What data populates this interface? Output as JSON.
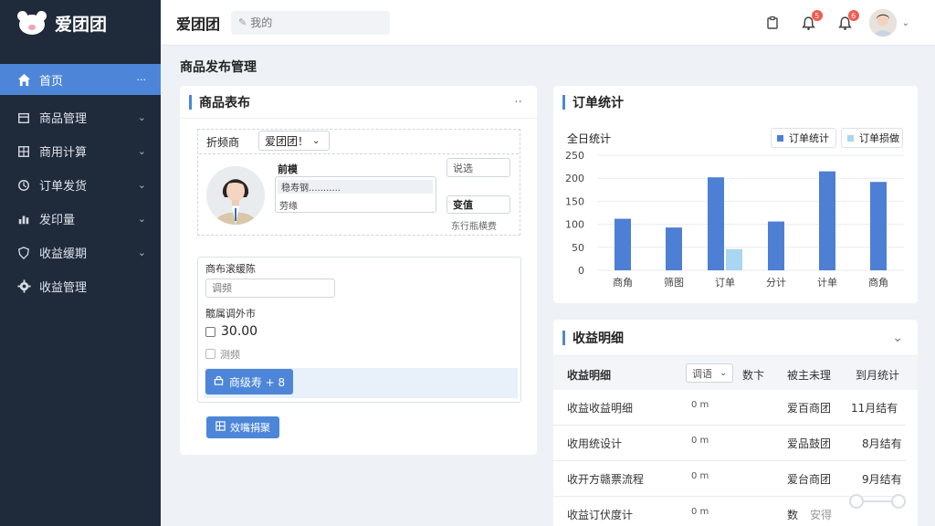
{
  "app": {
    "name": "爱团团"
  },
  "sidebar": {
    "items": [
      {
        "label": "首页",
        "icon": "home-icon",
        "active": true,
        "suffix": "···"
      },
      {
        "label": "商品管理",
        "icon": "box-icon"
      },
      {
        "label": "商用计算",
        "icon": "grid-icon"
      },
      {
        "label": "订单发货",
        "icon": "clock-icon"
      },
      {
        "label": "发印量",
        "icon": "bars-icon"
      },
      {
        "label": "收益缓期",
        "icon": "shield-icon"
      },
      {
        "label": "收益管理",
        "icon": "gear-icon"
      }
    ]
  },
  "header": {
    "title": "爱团团",
    "search_placeholder": "我的",
    "notify_badge_1": "5",
    "notify_badge_2": "6"
  },
  "page": {
    "title": "商品发布管理"
  },
  "product_card": {
    "title": "商品表布",
    "more": "··",
    "filter_label": "折频商",
    "filter_select": "爱团团！",
    "field_label_1": "前模",
    "field_value_1": "稳寿钢...........",
    "field_value_2": "劳缘",
    "side_field_1": "说选",
    "side_label_2": "变值",
    "side_field_2": "东行瓶横费",
    "section_label": "商布滚缓陈",
    "input_placeholder": "调频",
    "price_label": "髋属调外市",
    "price_value": "30.00",
    "check_label": "测频",
    "submit_button": "商级寿 + 8",
    "footer_button": "效嘴捐聚"
  },
  "order_card": {
    "title": "订单统计",
    "subtitle": "全日统计",
    "legend_1": "订单统计",
    "legend_2": "订单损做"
  },
  "chart_data": {
    "type": "bar",
    "categories": [
      "商角",
      "筛图",
      "订单",
      "分计",
      "计单",
      "商角"
    ],
    "series": [
      {
        "name": "订单统计",
        "color": "#4d7fd4",
        "values": [
          112,
          93,
          202,
          106,
          215,
          192
        ]
      },
      {
        "name": "订单损做",
        "color": "#a9d6f2",
        "values": [
          0,
          0,
          46,
          0,
          0,
          0
        ]
      }
    ],
    "yticks": [
      "250",
      "200",
      "150",
      "100",
      "50",
      "0"
    ],
    "ylim": [
      0,
      250
    ],
    "grid": true,
    "legend": "top-right"
  },
  "income_card": {
    "title": "收益明细",
    "header": {
      "col1": "收益明细",
      "filter": "调语",
      "col2": "数卞",
      "col3": "被主未理",
      "col4": "到月统计"
    },
    "rows": [
      {
        "c1": "收益收益明细",
        "c2": "0 m",
        "c3": "爱百商团",
        "c4": "11月结有"
      },
      {
        "c1": "收用统设计",
        "c2": "0 m",
        "c3": "爱品鼓团",
        "c4": "8月结有"
      },
      {
        "c1": "收开方赣票流程",
        "c2": "0 m",
        "c3": "爱台商团",
        "c4": "9月结有"
      },
      {
        "c1": "收益订伏度计",
        "c2": "0 m",
        "c3": "数",
        "c4": "安得"
      }
    ]
  }
}
